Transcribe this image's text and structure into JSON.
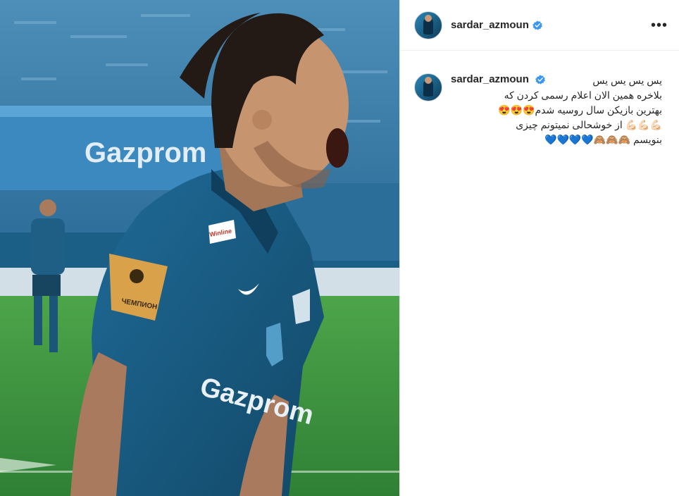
{
  "post": {
    "username": "sardar_azmoun",
    "caption": "یس یس یس یس\nبلاخره همین الان اعلام رسمی کردن که\nبهترین بازیکن سال روسیه شدم😍😍😍\n💪🏻💪🏻💪🏻 از خوشحالی نمیتونم چیزی\nبنویسم 🙈🙈🙈💙💙💙💙",
    "more_label": "•••",
    "photo_text": {
      "sponsor": "Gazprom",
      "patch": "ЧЕМПИОН",
      "brand": "Winline"
    }
  },
  "colors": {
    "verified": "#3897f0",
    "jersey": "#1a5b85",
    "pitch": "#3b9a3e"
  }
}
